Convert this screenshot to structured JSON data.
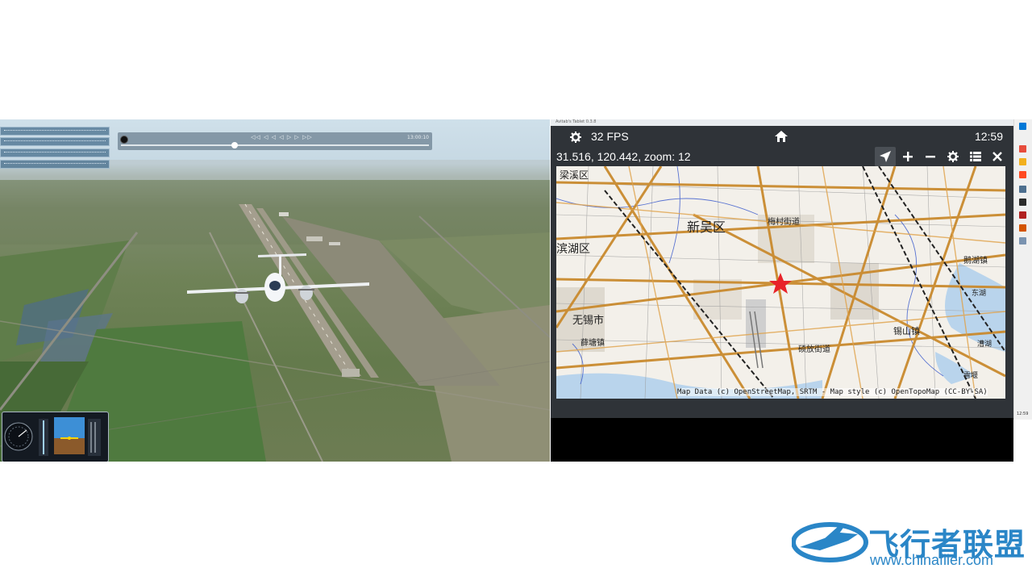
{
  "simulator": {
    "replay_time": "13:00:10",
    "replay_controls": "◁◁ ◁ ◁ ◁ ▷ ▷ ▷▷",
    "replay_progress": 0.37
  },
  "tablet": {
    "window_title": "Avitab's Tablet 0.3.8",
    "fps": "32 FPS",
    "clock": "12:59",
    "coords": "31.516, 120.442, zoom: 12",
    "map": {
      "attribution": "Map Data (c) OpenStreetMap, SRTM - Map style (c) OpenTopoMap (CC-BY-SA)",
      "labels": [
        "梁溪区",
        "新吴区",
        "梅村街道",
        "滨湖区",
        "无锡市",
        "硕放街道",
        "鹅湖镇",
        "锡山镇",
        "漕湖",
        "雪堰",
        "薛塘镇",
        "东湖"
      ],
      "colors": {
        "major_road": "#c98a2e",
        "rail": "#222222",
        "water": "#b9d4ec",
        "marker": "#e8232a"
      }
    }
  },
  "taskbar": {
    "time": "12:59"
  },
  "watermark": {
    "title": "飞行者联盟",
    "url": "www.chinaflier.com"
  }
}
